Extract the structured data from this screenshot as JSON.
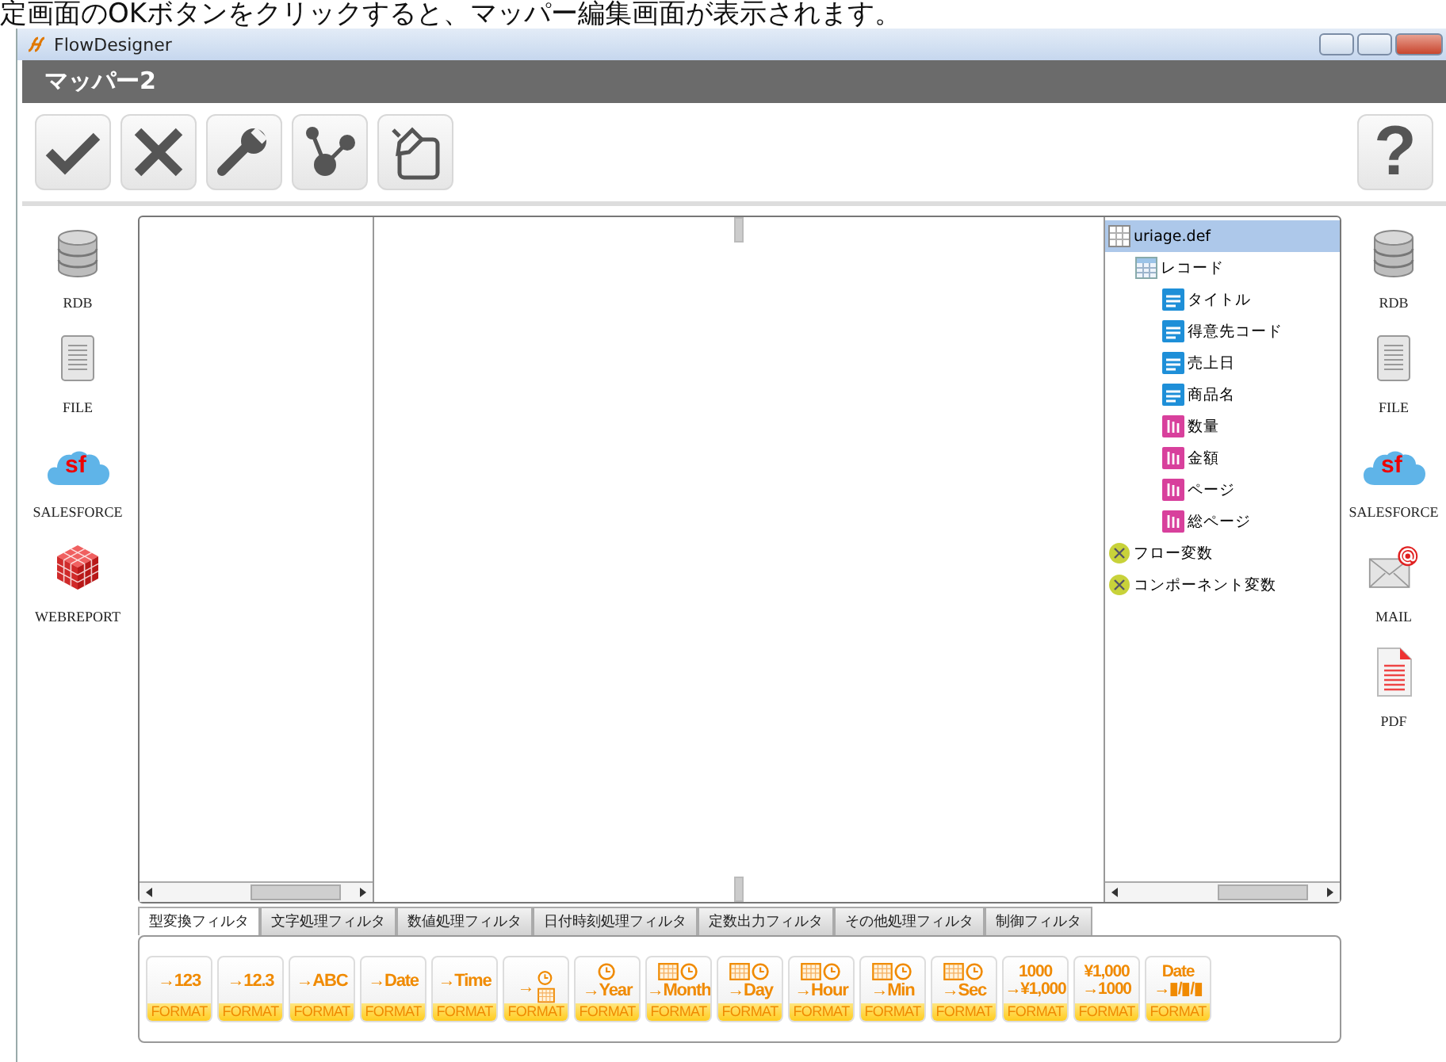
{
  "caption": "定画面のOKボタンをクリックすると、マッパー編集画面が表示されます。",
  "window": {
    "title": "FlowDesigner"
  },
  "header": {
    "title": "マッパー2"
  },
  "toolbar": {
    "help": "?"
  },
  "left_sidebar": [
    {
      "kind": "database",
      "label": "RDB"
    },
    {
      "kind": "document",
      "label": "FILE"
    },
    {
      "kind": "cloud",
      "label": "SALESFORCE",
      "logo": "sf"
    },
    {
      "kind": "cube",
      "label": "WEBREPORT"
    }
  ],
  "right_sidebar": [
    {
      "kind": "database",
      "label": "RDB"
    },
    {
      "kind": "document",
      "label": "FILE"
    },
    {
      "kind": "cloud",
      "label": "SALESFORCE",
      "logo": "sf"
    },
    {
      "kind": "mail",
      "label": "MAIL"
    },
    {
      "kind": "pdf",
      "label": "PDF"
    }
  ],
  "tree": [
    {
      "kind": "table",
      "label": "uriage.def",
      "selected": true,
      "children": [
        {
          "kind": "record",
          "label": "レコード",
          "selected": false,
          "children": [
            {
              "kind": "text",
              "label": "タイトル",
              "selected": false
            },
            {
              "kind": "text",
              "label": "得意先コード",
              "selected": false
            },
            {
              "kind": "text",
              "label": "売上日",
              "selected": false
            },
            {
              "kind": "text",
              "label": "商品名",
              "selected": false
            },
            {
              "kind": "number",
              "label": "数量",
              "selected": false
            },
            {
              "kind": "number",
              "label": "金額",
              "selected": false
            },
            {
              "kind": "number",
              "label": "ページ",
              "selected": false
            },
            {
              "kind": "number",
              "label": "総ページ",
              "selected": false
            }
          ]
        }
      ]
    },
    {
      "kind": "variable",
      "label": "フロー変数",
      "selected": false
    },
    {
      "kind": "variable",
      "label": "コンポーネント変数",
      "selected": false
    }
  ],
  "filter_tabs": [
    {
      "label": "型変換フィルタ",
      "selected": true
    },
    {
      "label": "文字処理フィルタ",
      "selected": false
    },
    {
      "label": "数値処理フィルタ",
      "selected": false
    },
    {
      "label": "日付時刻処理フィルタ",
      "selected": false
    },
    {
      "label": "定数出力フィルタ",
      "selected": false
    },
    {
      "label": "その他処理フィルタ",
      "selected": false
    },
    {
      "label": "制御フィルタ",
      "selected": false
    }
  ],
  "format_buttons": [
    {
      "kind": "plain",
      "lines": [
        "→123"
      ],
      "label": "FORMAT"
    },
    {
      "kind": "plain",
      "lines": [
        "→12.3"
      ],
      "label": "FORMAT"
    },
    {
      "kind": "plain",
      "lines": [
        "→ABC"
      ],
      "label": "FORMAT"
    },
    {
      "kind": "plain",
      "lines": [
        "→Date"
      ],
      "label": "FORMAT"
    },
    {
      "kind": "plain",
      "lines": [
        "→Time"
      ],
      "label": "FORMAT"
    },
    {
      "kind": "clock-calendar",
      "lines": [
        "→"
      ],
      "label": "FORMAT"
    },
    {
      "kind": "clock",
      "lines": [
        "→Year"
      ],
      "label": "FORMAT"
    },
    {
      "kind": "calendar-clock",
      "lines": [
        "→Month"
      ],
      "label": "FORMAT"
    },
    {
      "kind": "calendar-clock",
      "lines": [
        "→Day"
      ],
      "label": "FORMAT"
    },
    {
      "kind": "calendar-clock",
      "lines": [
        "→Hour"
      ],
      "label": "FORMAT"
    },
    {
      "kind": "calendar-clock",
      "lines": [
        "→Min"
      ],
      "label": "FORMAT"
    },
    {
      "kind": "calendar-clock",
      "lines": [
        "→Sec"
      ],
      "label": "FORMAT"
    },
    {
      "kind": "plain",
      "lines": [
        "1000",
        "→¥1,000"
      ],
      "label": "FORMAT"
    },
    {
      "kind": "plain",
      "lines": [
        "¥1,000",
        "→1000"
      ],
      "label": "FORMAT"
    },
    {
      "kind": "plain",
      "lines": [
        "Date",
        "→▮/▮/▮"
      ],
      "label": "FORMAT"
    }
  ]
}
